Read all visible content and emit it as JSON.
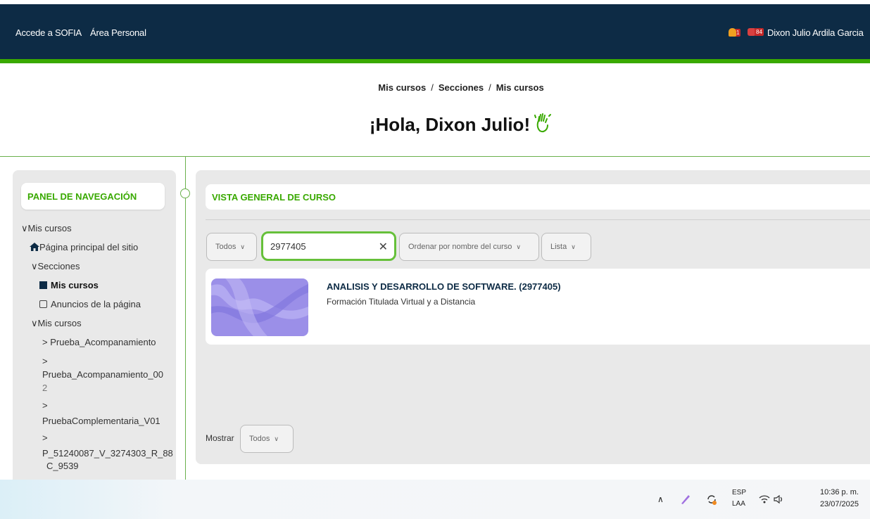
{
  "topbar": {
    "link_sofia": "Accede a SOFIA",
    "link_area": "Área Personal",
    "notif_count": "1",
    "msg_count": "84",
    "user_name": "Dixon Julio Ardila Garcia"
  },
  "header": {
    "breadcrumb": [
      "Mis cursos",
      "Secciones",
      "Mis cursos"
    ],
    "greeting": "¡Hola, Dixon Julio!"
  },
  "sidebar": {
    "title": "PANEL DE NAVEGACIÓN",
    "items": [
      {
        "label": "Mis cursos"
      },
      {
        "label": "Página principal del sitio"
      },
      {
        "label": "Secciones"
      },
      {
        "label": "Mis cursos"
      },
      {
        "label": "Anuncios de la página"
      },
      {
        "label": "Mis cursos"
      },
      {
        "label": "Prueba_Acompanamiento"
      },
      {
        "label": "Prueba_Acompanamiento_00"
      },
      {
        "label": "2"
      },
      {
        "label": "PruebaComplementaria_V01"
      },
      {
        "label": "P_51240087_V_3274303_R_88"
      },
      {
        "label": "C_9539"
      }
    ]
  },
  "main": {
    "title": "VISTA GENERAL DE CURSO",
    "filter_label": "Todos",
    "search_value": "2977405",
    "sort_label": "Ordenar por nombre del curso",
    "view_label": "Lista",
    "course": {
      "name": "ANALISIS Y DESARROLLO DE SOFTWARE. (2977405)",
      "category": "Formación Titulada Virtual y a Distancia"
    },
    "show_label": "Mostrar",
    "show_value": "Todos"
  },
  "taskbar": {
    "lang_top": "ESP",
    "lang_bottom": "LAA",
    "time": "10:36 p. m.",
    "date": "23/07/2025"
  },
  "colors": {
    "topbar": "#0d2b45",
    "accent_green": "#39a900",
    "thumb": "#9b8fe8"
  }
}
